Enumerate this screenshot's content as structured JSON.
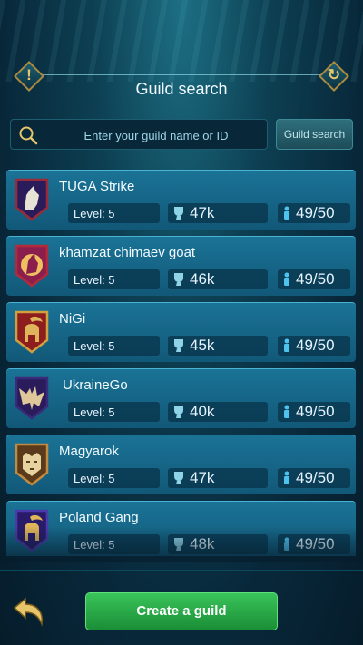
{
  "header": {
    "title": "Guild search"
  },
  "search": {
    "placeholder": "Enter your guild name or ID",
    "button_label": "Guild search"
  },
  "guilds": [
    {
      "name": "TUGA Strike",
      "level": "Level: 5",
      "power": "47k",
      "members": "49/50",
      "emblem": "wolf",
      "emblem_color": "#2a1b5a"
    },
    {
      "name": "khamzat chimaev goat",
      "level": "Level: 5",
      "power": "46k",
      "members": "49/50",
      "emblem": "wolf",
      "emblem_color": "#8a1f4e"
    },
    {
      "name": "NiGi",
      "level": "Level: 5",
      "power": "45k",
      "members": "49/50",
      "emblem": "spartan-helmet",
      "emblem_color": "#8e1d1d"
    },
    {
      "name": "UkraineGo",
      "level": "Level: 5",
      "power": "40k",
      "members": "49/50",
      "emblem": "bat",
      "emblem_color": "#2a1b5a"
    },
    {
      "name": "Magyarok",
      "level": "Level: 5",
      "power": "47k",
      "members": "49/50",
      "emblem": "tiger",
      "emblem_color": "#5a3a1a"
    },
    {
      "name": "Poland Gang",
      "level": "Level: 5",
      "power": "48k",
      "members": "49/50",
      "emblem": "spartan-helmet",
      "emblem_color": "#2a1b6a"
    }
  ],
  "footer": {
    "create_label": "Create a guild"
  }
}
